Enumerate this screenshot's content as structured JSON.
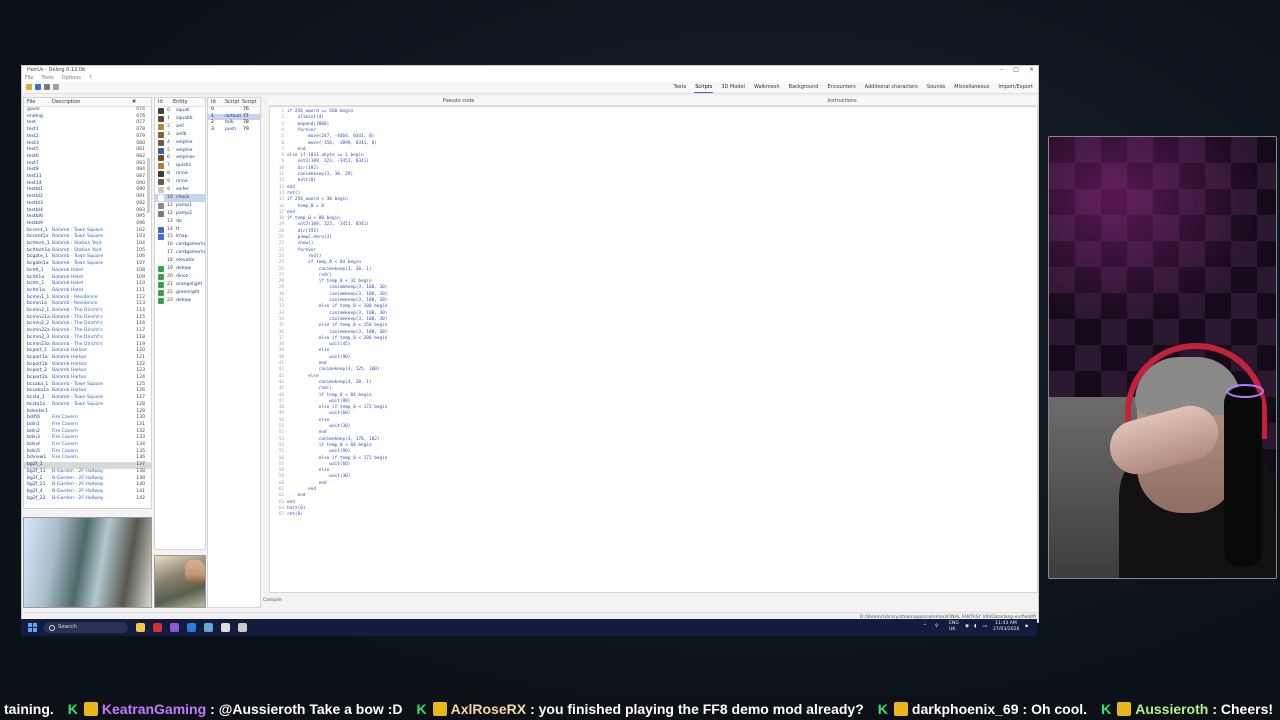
{
  "app": {
    "title": "HeirUs - Deling 0.12.0b",
    "menu": [
      "File",
      "Tools",
      "Options",
      "?"
    ],
    "tabs": [
      "Texts",
      "Scripts",
      "3D Model",
      "Walkmesh",
      "Background",
      "Encounters",
      "Additional characters",
      "Sounds",
      "Miscellaneous",
      "Import/Export"
    ],
    "active_tab": "Scripts",
    "field_list": {
      "headers": {
        "file": "File",
        "description": "Description",
        "num": "#"
      },
      "rows": [
        {
          "id": "gover",
          "desc": "",
          "num": "074"
        },
        {
          "id": "ending",
          "desc": "",
          "num": "076"
        },
        {
          "id": "test",
          "desc": "",
          "num": "077"
        },
        {
          "id": "test1",
          "desc": "",
          "num": "078"
        },
        {
          "id": "test2",
          "desc": "",
          "num": "079"
        },
        {
          "id": "test3",
          "desc": "",
          "num": "080"
        },
        {
          "id": "test5",
          "desc": "",
          "num": "081"
        },
        {
          "id": "test6",
          "desc": "",
          "num": "082"
        },
        {
          "id": "test7",
          "desc": "",
          "num": "083"
        },
        {
          "id": "test8",
          "desc": "",
          "num": "084"
        },
        {
          "id": "test11",
          "desc": "",
          "num": "087"
        },
        {
          "id": "test14",
          "desc": "",
          "num": "090"
        },
        {
          "id": "testbl1",
          "desc": "",
          "num": "090"
        },
        {
          "id": "testbl2",
          "desc": "",
          "num": "091"
        },
        {
          "id": "testbl3",
          "desc": "",
          "num": "092"
        },
        {
          "id": "testbl4",
          "desc": "",
          "num": "093"
        },
        {
          "id": "testbl6",
          "desc": "",
          "num": "095"
        },
        {
          "id": "testbl9",
          "desc": "",
          "num": "096"
        },
        {
          "id": "bccent_1",
          "desc": "Balamb - Town Square",
          "num": "102"
        },
        {
          "id": "bccent1a",
          "desc": "Balamb - Town Square",
          "num": "103"
        },
        {
          "id": "bchtom_1",
          "desc": "Balamb - Station Yard",
          "num": "104"
        },
        {
          "id": "bchtom1a",
          "desc": "Balamb - Station Yard",
          "num": "105"
        },
        {
          "id": "bcgate_1",
          "desc": "Balamb - Town Square",
          "num": "106"
        },
        {
          "id": "bcgate1a",
          "desc": "Balamb - Town Square",
          "num": "107"
        },
        {
          "id": "bchtl_1",
          "desc": "Balamb Hotel",
          "num": "108"
        },
        {
          "id": "bchtl1a",
          "desc": "Balamb Hotel",
          "num": "109"
        },
        {
          "id": "bchtr_1",
          "desc": "Balamb Hotel",
          "num": "110"
        },
        {
          "id": "bchtr1a",
          "desc": "Balamb Hotel",
          "num": "111"
        },
        {
          "id": "bcmin1_1",
          "desc": "Balamb - Residence",
          "num": "112"
        },
        {
          "id": "bcmin1a",
          "desc": "Balamb - Residence",
          "num": "113"
        },
        {
          "id": "bcmin2_1",
          "desc": "Balamb - The Dincht's",
          "num": "114"
        },
        {
          "id": "bcmin21a",
          "desc": "Balamb - The Dincht's",
          "num": "115"
        },
        {
          "id": "bcmin2_2",
          "desc": "Balamb - The Dincht's",
          "num": "116"
        },
        {
          "id": "bcmin22a",
          "desc": "Balamb - The Dincht's",
          "num": "117"
        },
        {
          "id": "bcmin2_3",
          "desc": "Balamb - The Dincht's",
          "num": "118"
        },
        {
          "id": "bcmin23a",
          "desc": "Balamb - The Dincht's",
          "num": "119"
        },
        {
          "id": "bcport_1",
          "desc": "Balamb Harbor",
          "num": "120"
        },
        {
          "id": "bcport1a",
          "desc": "Balamb Harbor",
          "num": "121"
        },
        {
          "id": "bcport1b",
          "desc": "Balamb Harbor",
          "num": "122"
        },
        {
          "id": "bcport_2",
          "desc": "Balamb Harbor",
          "num": "123"
        },
        {
          "id": "bcport2a",
          "desc": "Balamb Harbor",
          "num": "124"
        },
        {
          "id": "bcsaka_1",
          "desc": "Balamb - Town Square",
          "num": "125"
        },
        {
          "id": "bcsaka1a",
          "desc": "Balamb Harbor",
          "num": "126"
        },
        {
          "id": "bcsta_1",
          "desc": "Balamb - Town Square",
          "num": "127"
        },
        {
          "id": "bcsta1a",
          "desc": "Balamb - Town Square",
          "num": "128"
        },
        {
          "id": "bdenter1",
          "desc": "",
          "num": "129"
        },
        {
          "id": "bdifi0",
          "desc": "Fire Cavern",
          "num": "130"
        },
        {
          "id": "bdin1",
          "desc": "Fire Cavern",
          "num": "131"
        },
        {
          "id": "bdin2",
          "desc": "Fire Cavern",
          "num": "132"
        },
        {
          "id": "bdin3",
          "desc": "Fire Cavern",
          "num": "133"
        },
        {
          "id": "bdin4",
          "desc": "Fire Cavern",
          "num": "134"
        },
        {
          "id": "bdin5",
          "desc": "Fire Cavern",
          "num": "135"
        },
        {
          "id": "bdview1",
          "desc": "Fire Cavern",
          "num": "136"
        },
        {
          "id": "bg2f_1",
          "desc": "",
          "num": "137"
        },
        {
          "id": "bg2f_11",
          "desc": "B-Garden - 2F Hallway",
          "num": "138"
        },
        {
          "id": "bg2f_2",
          "desc": "B-Garden - 2F Hallway",
          "num": "139"
        },
        {
          "id": "bg2f_21",
          "desc": "B-Garden - 2F Hallway",
          "num": "140"
        },
        {
          "id": "bg2f_4",
          "desc": "B-Garden - 2F Hallway",
          "num": "141"
        },
        {
          "id": "bg2f_22",
          "desc": "B-Garden - 2F Hallway",
          "num": "142"
        }
      ],
      "selected_index": 53
    },
    "entity_list": {
      "headers": {
        "id": "Id",
        "entity": "Entity"
      },
      "rows": [
        {
          "id": "0",
          "name": "squall",
          "color": "#4a3f36"
        },
        {
          "id": "1",
          "name": "squallb",
          "color": "#5b4a3b"
        },
        {
          "id": "2",
          "name": "zell",
          "color": "#b5883a"
        },
        {
          "id": "3",
          "name": "zellb",
          "color": "#8a6030"
        },
        {
          "id": "4",
          "name": "selphie",
          "color": "#6f5a49"
        },
        {
          "id": "5",
          "name": "selphie",
          "color": "#3a5fa8"
        },
        {
          "id": "6",
          "name": "selphies",
          "color": "#7a4a2c"
        },
        {
          "id": "7",
          "name": "quistis",
          "color": "#bf7a2e"
        },
        {
          "id": "8",
          "name": "rinoa",
          "color": "#3b3b3b"
        },
        {
          "id": "9",
          "name": "rinoa",
          "color": "#6b5848"
        },
        {
          "id": "9",
          "name": "seifer",
          "color": "#cfc7b8"
        },
        {
          "id": "10",
          "name": "check",
          "color": "#ffffff"
        },
        {
          "id": "11",
          "name": "pamp1",
          "color": "#8b8b8b"
        },
        {
          "id": "12",
          "name": "pamp2",
          "color": "#7a7a7a"
        },
        {
          "id": "13",
          "name": "do",
          "color": "#ffffff"
        },
        {
          "id": "14",
          "name": "tt",
          "color": "#3a6fcf"
        },
        {
          "id": "15",
          "name": "lmap",
          "color": "#3a6fcf"
        },
        {
          "id": "16",
          "name": "cardgamemaster",
          "color": "#ffffff"
        },
        {
          "id": "17",
          "name": "cardgamemaster",
          "color": "#ffffff"
        },
        {
          "id": "18",
          "name": "elevator",
          "color": "#ffffff"
        },
        {
          "id": "19",
          "name": "dekaw",
          "color": "#3aa04a"
        },
        {
          "id": "20",
          "name": "dinoz",
          "color": "#3aa04a"
        },
        {
          "id": "21",
          "name": "orangelight",
          "color": "#3aa04a"
        },
        {
          "id": "22",
          "name": "greenlight",
          "color": "#3aa04a"
        },
        {
          "id": "23",
          "name": "dekaw",
          "color": "#3aa04a"
        }
      ],
      "selected_index": 11
    },
    "script_list": {
      "headers": {
        "id": "Id",
        "script": "Script",
        "script2": "Script"
      },
      "rows": [
        {
          "id": "0",
          "name": "",
          "num": "76"
        },
        {
          "id": "1",
          "name": "default",
          "num": "77"
        },
        {
          "id": "2",
          "name": "talk",
          "num": "78"
        },
        {
          "id": "3",
          "name": "push",
          "num": "79"
        }
      ],
      "selected_index": 1
    },
    "code_header": "Pseudo code",
    "instructions_header": "Instructions",
    "code_lines": [
      "if 256_uword == 560 begin",
      "    allmint(4)",
      "    mapend(3000)",
      "    forever",
      "        move(247, -4464, 8341, 0)",
      "        move(-156, -3899, 8341, 0)",
      "    end",
      "else if 1031_ubyte == 1 begin",
      "    set3(109, 323, -3451, 8341)",
      "    dir(192)",
      "    canimekeep(3, 30, 29)",
      "    halt(0)",
      "end",
      "ret()",
      "if 256_uword < 30 begin",
      "    temp_0 = 0",
      "end",
      "if temp_0 < 80 begin",
      "    set3(109, 323, -3451, 8341)",
      "    dir(192)",
      "    pamp2.dero(3)",
      "    show()",
      "    forever",
      "        rnd()",
      "        if temp_0 < 84 begin",
      "            canimekeep(3, 30, 1)",
      "            rnd()",
      "            if temp_0 < 32 begin",
      "                canimekeep(3, 100, 30)",
      "                canimekeep(3, 100, 30)",
      "                canimekeep(3, 100, 30)",
      "            else if temp_0 < 100 begin",
      "                canimekeep(3, 100, 30)",
      "                canimekeep(3, 100, 30)",
      "            else if temp_0 < 150 begin",
      "                canimekeep(3, 100, 30)",
      "            else if temp_0 < 200 begin",
      "                wait(45)",
      "            else",
      "                wait(90)",
      "            end",
      "            canimekeep(3, 125, 100)",
      "        else",
      "            canimekeep(4, 20, 1)",
      "            rnd()",
      "            if temp_0 < 84 begin",
      "                wait(90)",
      "            else if temp_0 < 172 begin",
      "                wait(60)",
      "            else",
      "                wait(30)",
      "            end",
      "            canimekeep(4, 170, 182)",
      "            if temp_0 < 84 begin",
      "                wait(90)",
      "            else if temp_0 < 172 begin",
      "                wait(60)",
      "            else",
      "                wait(30)",
      "            end",
      "        end",
      "    end",
      "end",
      "halt(0)",
      "ret(8)"
    ],
    "compile_label": "Compile",
    "path": "D:/Steam/Library/steamapps/common/FINAL FANTASY VIII/Data/lang-en/field/fi"
  },
  "taskbar": {
    "search_placeholder": "Search",
    "lang": "ENG",
    "region": "UK",
    "time": "11:43 AM",
    "date": "27/03/2026",
    "apps": [
      {
        "name": "file-explorer-icon",
        "color": "#f2c744"
      },
      {
        "name": "app-red-icon",
        "color": "#d63030"
      },
      {
        "name": "app-purple-icon",
        "color": "#8a5ad6"
      },
      {
        "name": "app-multi-icon",
        "color": "#2c7be5"
      },
      {
        "name": "steam-icon",
        "color": "#6aa6d6"
      },
      {
        "name": "app-white-icon",
        "color": "#dddddd"
      },
      {
        "name": "app-gear-icon",
        "color": "#cccccc"
      }
    ]
  },
  "ticker": {
    "lead": "taining.",
    "messages": [
      {
        "user": "KeatranGaming",
        "text": ": @Aussieroth Take a bow :D"
      },
      {
        "user": "AxlRoseRX",
        "text": ": you finished playing the FF8 demo mod already?"
      },
      {
        "user": "darkphoenix_69",
        "text": ": Oh cool."
      },
      {
        "user": "Aussieroth",
        "text": ": Cheers!"
      }
    ]
  },
  "colors": {
    "accent": "#3b6dc4",
    "code_text": "#3b4cb0",
    "ticker_k": "#2ee66b"
  }
}
